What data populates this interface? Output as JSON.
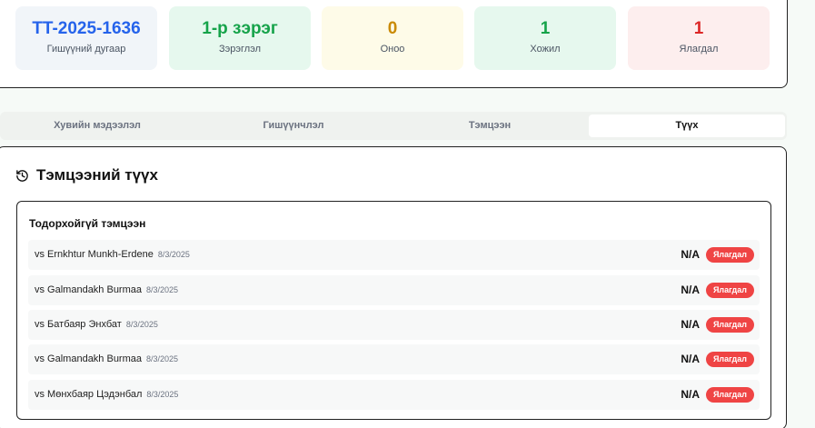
{
  "stats": [
    {
      "value": "TT-2025-1636",
      "label": "Гишүүний дугаар"
    },
    {
      "value": "1-р зэрэг",
      "label": "Зэрэглэл"
    },
    {
      "value": "0",
      "label": "Оноо"
    },
    {
      "value": "1",
      "label": "Хожил"
    },
    {
      "value": "1",
      "label": "Ялагдал"
    }
  ],
  "tabs": [
    "Хувийн мэдээлэл",
    "Гишүүнчлэл",
    "Тэмцээн",
    "Түүх"
  ],
  "active_tab": "Түүх",
  "history": {
    "title": "Тэмцээний түүх",
    "icon": "history-icon",
    "group_title": "Тодорхойгүй тэмцээн",
    "matches": [
      {
        "opponent": "vs Ernkhtur Munkh-Erdene",
        "date": "8/3/2025",
        "score": "N/A",
        "result": "Ялагдал"
      },
      {
        "opponent": "vs Galmandakh Burmaa",
        "date": "8/3/2025",
        "score": "N/A",
        "result": "Ялагдал"
      },
      {
        "opponent": "vs Батбаяр Энхбат",
        "date": "8/3/2025",
        "score": "N/A",
        "result": "Ялагдал"
      },
      {
        "opponent": "vs Galmandakh Burmaa",
        "date": "8/3/2025",
        "score": "N/A",
        "result": "Ялагдал"
      },
      {
        "opponent": "vs Мөнхбаяр Цэдэнбал",
        "date": "8/3/2025",
        "score": "N/A",
        "result": "Ялагдал"
      }
    ]
  },
  "colors": {
    "member_id": "#2563eb",
    "rank": "#16a34a",
    "points": "#ca8a04",
    "wins": "#16a34a",
    "losses": "#dc2626",
    "loss_badge": "#ef4444"
  }
}
